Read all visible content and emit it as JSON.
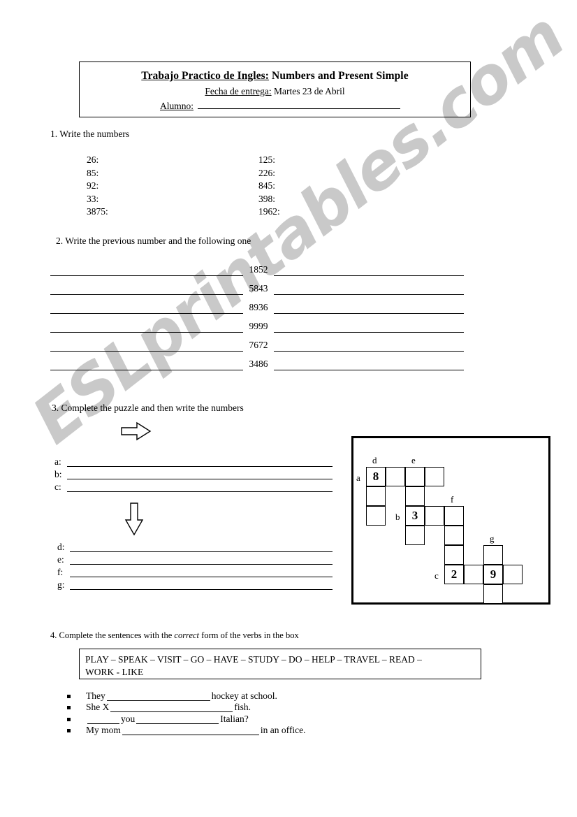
{
  "header": {
    "title_label": "Trabajo Practico de Ingles:",
    "title_rest": " Numbers and Present Simple",
    "date_label": "Fecha de entrega:",
    "date_value": " Martes 23 de Abril",
    "student_label": "Alumno:"
  },
  "q1": {
    "heading": "1. Write the numbers",
    "rows": [
      {
        "left": "26:",
        "right": "125:"
      },
      {
        "left": "85:",
        "right": "226:"
      },
      {
        "left": "92:",
        "right": "845:"
      },
      {
        "left": "33:",
        "right": "398:"
      },
      {
        "left": "3875:",
        "right": "1962:"
      }
    ]
  },
  "q2": {
    "heading": "2. Write the previous number and the following one",
    "numbers": [
      "1852",
      "5843",
      "8936",
      "9999",
      "7672",
      "3486"
    ]
  },
  "q3": {
    "heading": "3. Complete the puzzle and then write the numbers",
    "arrow_right": "arrow-right",
    "arrow_down": "arrow-down",
    "group_one": [
      "a:",
      "b:",
      "c:"
    ],
    "group_two": [
      "d:",
      "e:",
      "f:",
      "g:"
    ],
    "puzzle": {
      "labels": [
        {
          "text": "a",
          "col": 0,
          "row": 0,
          "side": "left"
        },
        {
          "text": "b",
          "col": 2,
          "row": 2,
          "side": "left"
        },
        {
          "text": "c",
          "col": 4,
          "row": 5,
          "side": "left"
        },
        {
          "text": "d",
          "col": 0,
          "row": 0,
          "side": "top"
        },
        {
          "text": "e",
          "col": 2,
          "row": 0,
          "side": "top"
        },
        {
          "text": "f",
          "col": 4,
          "row": 2,
          "side": "top"
        },
        {
          "text": "g",
          "col": 6,
          "row": 4,
          "side": "top"
        }
      ],
      "cells": [
        {
          "col": 0,
          "row": 0,
          "value": "8"
        },
        {
          "col": 1,
          "row": 0,
          "value": ""
        },
        {
          "col": 2,
          "row": 0,
          "value": ""
        },
        {
          "col": 3,
          "row": 0,
          "value": ""
        },
        {
          "col": 0,
          "row": 1,
          "value": ""
        },
        {
          "col": 2,
          "row": 1,
          "value": ""
        },
        {
          "col": 0,
          "row": 2,
          "value": ""
        },
        {
          "col": 2,
          "row": 2,
          "value": "3"
        },
        {
          "col": 3,
          "row": 2,
          "value": ""
        },
        {
          "col": 4,
          "row": 2,
          "value": ""
        },
        {
          "col": 2,
          "row": 3,
          "value": ""
        },
        {
          "col": 4,
          "row": 3,
          "value": ""
        },
        {
          "col": 4,
          "row": 4,
          "value": ""
        },
        {
          "col": 6,
          "row": 4,
          "value": ""
        },
        {
          "col": 4,
          "row": 5,
          "value": "2"
        },
        {
          "col": 5,
          "row": 5,
          "value": ""
        },
        {
          "col": 6,
          "row": 5,
          "value": "9"
        },
        {
          "col": 7,
          "row": 5,
          "value": ""
        },
        {
          "col": 6,
          "row": 6,
          "value": ""
        }
      ]
    }
  },
  "q4": {
    "heading_before": "4. Complete the sentences with the ",
    "heading_italic": "correct",
    "heading_after": " form of the verbs in the box",
    "verbs_line_1": "PLAY – SPEAK – VISIT – GO – HAVE – STUDY – DO – HELP – TRAVEL – READ –",
    "verbs_line_2": "WORK - LIKE",
    "sentences": [
      {
        "before": "They",
        "gap": 148,
        "after": "hockey at school."
      },
      {
        "before": "She X",
        "gap": 175,
        "after": "fish."
      },
      {
        "before": "",
        "gap": 46,
        "mid": "you",
        "gap2": 118,
        "after": "Italian?"
      },
      {
        "before": "My mom",
        "gap": 196,
        "after": "in an office."
      }
    ]
  },
  "watermark": {
    "text": "ESLprintables.com",
    "color": "#c9c9c9"
  }
}
